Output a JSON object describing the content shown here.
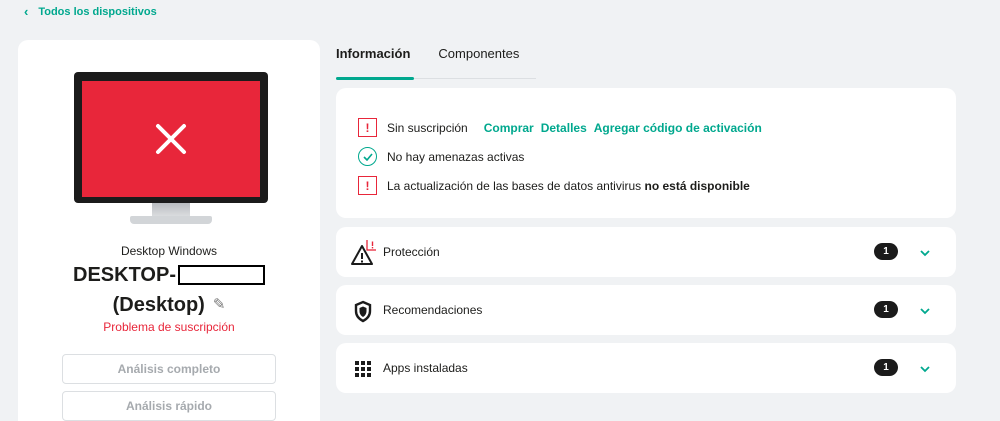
{
  "nav": {
    "back_label": "Todos los dispositivos"
  },
  "device": {
    "type": "Desktop Windows",
    "name_prefix": "DESKTOP-",
    "name_suffix": "(Desktop)",
    "problem": "Problema de suscripción",
    "actions": [
      "Análisis completo",
      "Análisis rápido"
    ],
    "screen_color": "#e8263a"
  },
  "tabs": [
    {
      "label": "Información",
      "active": true
    },
    {
      "label": "Componentes",
      "active": false
    }
  ],
  "status": {
    "subscription": "Sin suscripción",
    "links": [
      "Comprar",
      "Detalles",
      "Agregar código de activación"
    ],
    "threats": "No hay amenazas activas",
    "update_prefix": "La actualización de las bases de datos antivirus",
    "update_bold": "no está disponible"
  },
  "sections": [
    {
      "label": "Protección",
      "count": "1",
      "icon": "warning-triangle-icon"
    },
    {
      "label": "Recomendaciones",
      "count": "1",
      "icon": "shield-icon"
    },
    {
      "label": "Apps instaladas",
      "count": "1",
      "icon": "apps-grid-icon"
    }
  ],
  "colors": {
    "accent": "#00a88e",
    "danger": "#e8263a",
    "background": "#f0f2f4"
  }
}
